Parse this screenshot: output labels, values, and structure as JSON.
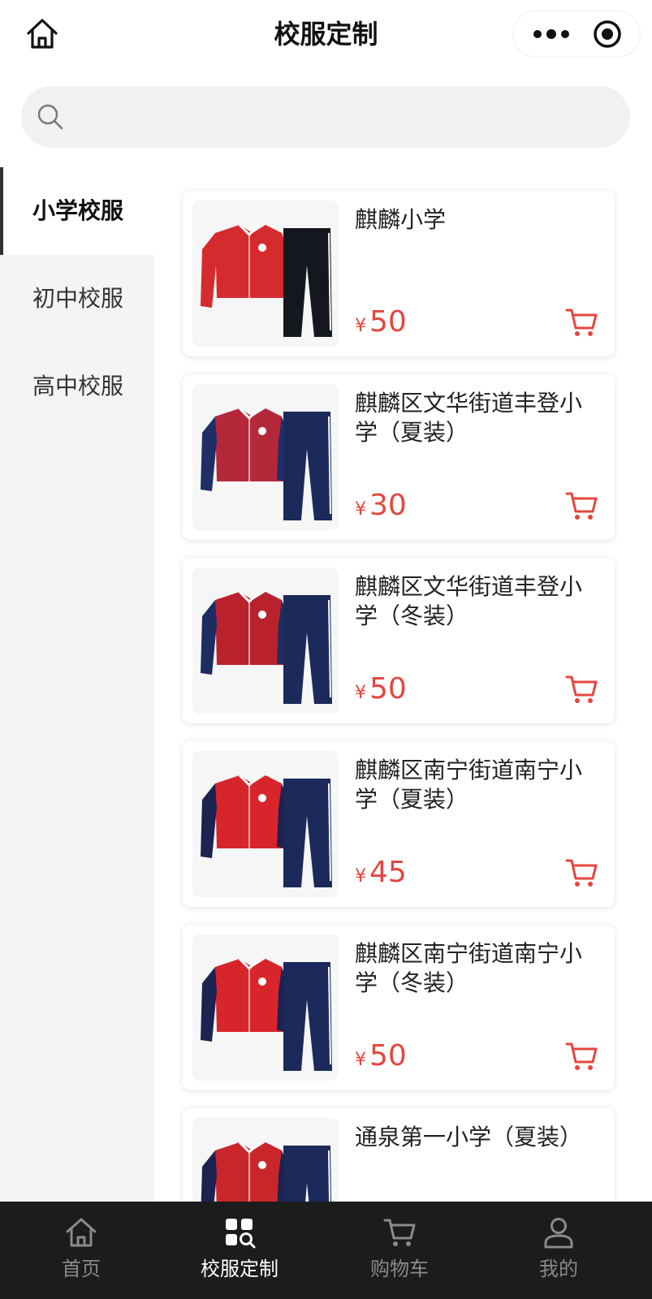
{
  "header": {
    "title": "校服定制",
    "home_icon": "home-icon",
    "more_icon": "more-dots-icon",
    "target_icon": "target-icon"
  },
  "search": {
    "placeholder": "",
    "icon": "search-icon"
  },
  "sidebar": {
    "items": [
      {
        "label": "小学校服",
        "active": true
      },
      {
        "label": "初中校服",
        "active": false
      },
      {
        "label": "高中校服",
        "active": false
      }
    ]
  },
  "products": [
    {
      "name": "麒麟小学",
      "currency": "¥",
      "price": "50",
      "jacket": "#d52b2f",
      "sleeve": "#d52b2f",
      "pants": "#15171e",
      "cart_icon": "cart-icon"
    },
    {
      "name": "麒麟区文华街道丰登小学（夏装）",
      "currency": "¥",
      "price": "30",
      "jacket": "#b5283a",
      "sleeve": "#1f2f66",
      "pants": "#1b2a5a",
      "cart_icon": "cart-icon"
    },
    {
      "name": "麒麟区文华街道丰登小学（冬装）",
      "currency": "¥",
      "price": "50",
      "jacket": "#b9222d",
      "sleeve": "#1c2d62",
      "pants": "#1b2a5a",
      "cart_icon": "cart-icon"
    },
    {
      "name": "麒麟区南宁街道南宁小学（夏装）",
      "currency": "¥",
      "price": "45",
      "jacket": "#d8252c",
      "sleeve": "#1c2350",
      "pants": "#1b2a5a",
      "cart_icon": "cart-icon"
    },
    {
      "name": "麒麟区南宁街道南宁小学（冬装）",
      "currency": "¥",
      "price": "50",
      "jacket": "#d8252c",
      "sleeve": "#1c2350",
      "pants": "#1b2a5a",
      "cart_icon": "cart-icon"
    },
    {
      "name": "通泉第一小学（夏装）",
      "currency": "¥",
      "price": "",
      "jacket": "#c9262c",
      "sleeve": "#1c2350",
      "pants": "#1b2a5a",
      "cart_icon": "cart-icon"
    }
  ],
  "tabbar": {
    "items": [
      {
        "label": "首页",
        "icon": "home-icon",
        "active": false
      },
      {
        "label": "校服定制",
        "icon": "grid-search-icon",
        "active": true
      },
      {
        "label": "购物车",
        "icon": "cart-icon",
        "active": false
      },
      {
        "label": "我的",
        "icon": "user-icon",
        "active": false
      }
    ]
  },
  "colors": {
    "accent": "#e3473f",
    "tabbar_bg": "#1c1c1c",
    "sidebar_bg": "#f4f4f4"
  }
}
